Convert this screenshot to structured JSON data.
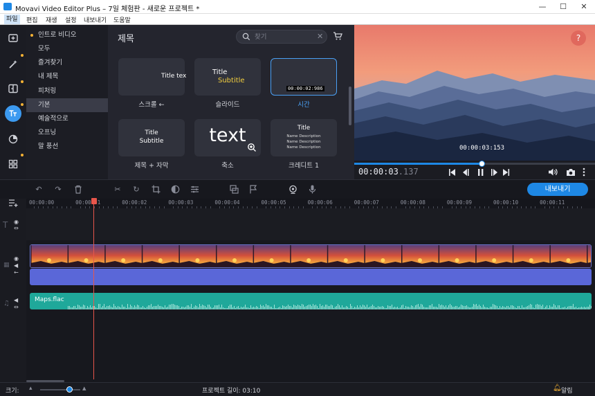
{
  "window": {
    "title": "Movavi Video Editor Plus – 7일 체험판 - 새로운 프로젝트 *",
    "minimize": "—",
    "maximize": "☐",
    "close": "✕"
  },
  "menu": [
    "파일",
    "편집",
    "재생",
    "설정",
    "내보내기",
    "도움말"
  ],
  "tools": [
    {
      "icon": "import-media-icon"
    },
    {
      "icon": "magic-wand-icon"
    },
    {
      "icon": "transitions-icon"
    },
    {
      "icon": "titles-icon"
    },
    {
      "icon": "stickers-icon"
    },
    {
      "icon": "more-tools-icon"
    }
  ],
  "categories": {
    "items": [
      "인트로 비디오",
      "모두",
      "즐겨찾기",
      "내 제목",
      "피처링",
      "기본",
      "예술적으로",
      "오프닝",
      "말 풍선"
    ],
    "active_index": 5
  },
  "gallery": {
    "heading": "제목",
    "search_placeholder": "찾기",
    "tiles": [
      {
        "label": "스크롤 ←",
        "preview": "Title tex"
      },
      {
        "label": "슬라이드",
        "preview_title": "Title",
        "preview_subtitle": "Subtitle"
      },
      {
        "label": "시간",
        "preview": "00:00:02:986"
      },
      {
        "label": "제목 + 자막",
        "preview_title": "Title",
        "preview_subtitle": "Subtitle"
      },
      {
        "label": "축소",
        "preview": "text"
      },
      {
        "label": "크레디트 1",
        "preview_title": "Title",
        "credits": [
          "Name Description",
          "Name Description",
          "Name Description"
        ]
      }
    ]
  },
  "preview": {
    "overlay_time": "00:00:03:153",
    "help": "?",
    "progress": 0.53
  },
  "playback": {
    "time_main": "00:00:03",
    "time_frac": ".137"
  },
  "timeline": {
    "export_label": "내보내기",
    "ticks": [
      "00:00:00",
      "00:00:01",
      "00:00:02",
      "00:00:03",
      "00:00:04",
      "00:00:05",
      "00:00:06",
      "00:00:07",
      "00:00:08",
      "00:00:09",
      "00:00:10",
      "00:00:11"
    ],
    "playhead_seconds": 1.4,
    "audio_clip": "Maps.flac"
  },
  "status": {
    "zoom_label": "크기:",
    "project_length": "프로젝트 길이: 03:10",
    "notifications": "알림",
    "zoom_level": 0.72
  },
  "colors": {
    "accent": "#1e88e5",
    "audio": "#1fa89a",
    "video_audio": "#5a67d8",
    "playhead": "#e8564b"
  }
}
